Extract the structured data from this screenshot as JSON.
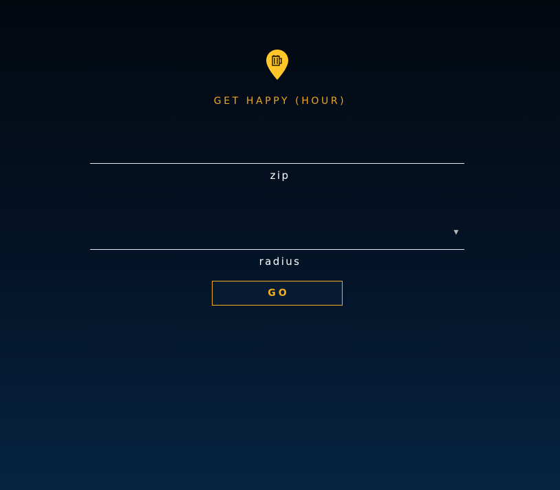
{
  "app": {
    "title": "GET HAPPY (HOUR)",
    "logo_icon": "beer-mug-map-pin-icon"
  },
  "form": {
    "zip": {
      "label": "zip",
      "value": ""
    },
    "radius": {
      "label": "radius",
      "selected": "",
      "dropdown_icon": "chevron-down-icon"
    },
    "submit_label": "GO"
  },
  "colors": {
    "accent": "#f0b020",
    "title_color": "#f0a820",
    "background_top": "#03080f",
    "background_bottom": "#062440",
    "text": "#ffffff"
  }
}
